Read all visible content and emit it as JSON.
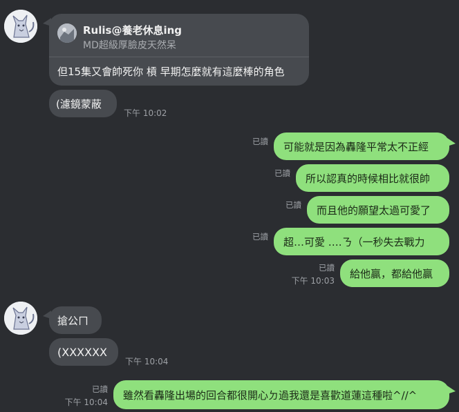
{
  "messages": {
    "quote": {
      "name": "Rulis@養老休息ing",
      "subtitle": "MD超級厚臉皮天然呆",
      "text": "但15集又會帥死你 槓 早期怎麼就有這麼棒的角色"
    },
    "m1": {
      "text": "(濾鏡蒙蔽",
      "time": "下午 10:02"
    },
    "o1": {
      "text": "可能就是因為轟隆平常太不正經",
      "read": "已讀"
    },
    "o2": {
      "text": "所以認真的時候相比就很帥",
      "read": "已讀"
    },
    "o3": {
      "text": "而且他的願望太過可愛了",
      "read": "已讀"
    },
    "o4": {
      "text": "超…可愛 ….ㄋ（一秒失去戰力",
      "read": "已讀"
    },
    "o5": {
      "text": "給他贏，都給他贏",
      "read": "已讀",
      "time": "下午 10:03"
    },
    "m2": {
      "text": "搶公ㄇ"
    },
    "m3": {
      "text": "(XXXXXX",
      "time": "下午 10:04"
    },
    "o6": {
      "text": "雖然看轟隆出場的回合都很開心ㄉ過我還是喜歡道蓮這種啦^//^",
      "read": "已讀",
      "time": "下午 10:04"
    }
  },
  "colors": {
    "incoming": "#474a4f",
    "outgoing": "#8fe07d",
    "background": "#2b2d31"
  },
  "icons": {
    "avatar": "wolf-sketch-avatar"
  }
}
